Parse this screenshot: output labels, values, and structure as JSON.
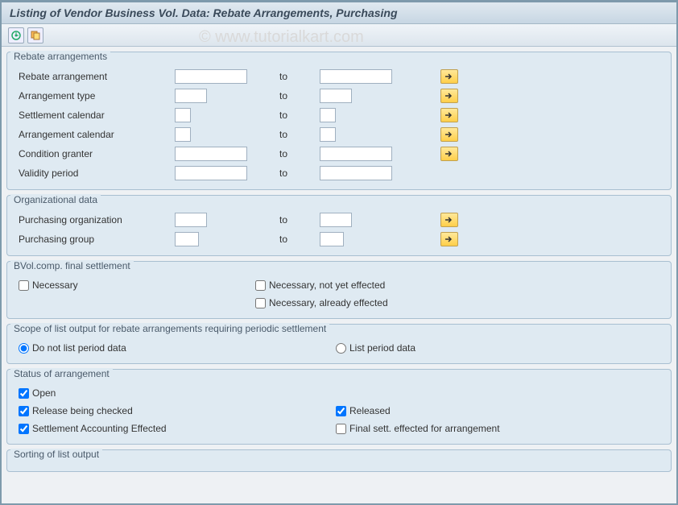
{
  "title": "Listing of Vendor Business Vol. Data: Rebate Arrangements, Purchasing",
  "watermark": "© www.tutorialkart.com",
  "labels": {
    "to": "to"
  },
  "panels": {
    "rebate": {
      "title": "Rebate arrangements",
      "rows": [
        {
          "label": "Rebate arrangement",
          "w1": "w80",
          "w2": "w80",
          "multi": true
        },
        {
          "label": "Arrangement type",
          "w1": "w40",
          "w2": "w40",
          "multi": true
        },
        {
          "label": "Settlement calendar",
          "w1": "w20",
          "w2": "w20",
          "multi": true
        },
        {
          "label": "Arrangement calendar",
          "w1": "w20",
          "w2": "w20",
          "multi": true
        },
        {
          "label": "Condition granter",
          "w1": "w80",
          "w2": "w80",
          "multi": true
        },
        {
          "label": "Validity period",
          "w1": "w80",
          "w2": "w80",
          "multi": false
        }
      ]
    },
    "org": {
      "title": "Organizational data",
      "rows": [
        {
          "label": "Purchasing organization",
          "w1": "w40",
          "w2": "w40",
          "multi": true
        },
        {
          "label": "Purchasing group",
          "w1": "w30",
          "w2": "w30",
          "multi": true
        }
      ]
    },
    "bvol": {
      "title": "BVol.comp. final settlement",
      "c1": "Necessary",
      "c2": "Necessary, not yet effected",
      "c3": "Necessary, already effected"
    },
    "scope": {
      "title": "Scope of list output for rebate arrangements requiring periodic settlement",
      "r1": "Do not list period data",
      "r2": "List period data"
    },
    "status": {
      "title": "Status of arrangement",
      "c1": "Open",
      "c2": "Release being checked",
      "c3": "Released",
      "c4": "Settlement Accounting Effected",
      "c5": "Final sett. effected for arrangement"
    },
    "sorting": {
      "title": "Sorting of list output"
    }
  }
}
